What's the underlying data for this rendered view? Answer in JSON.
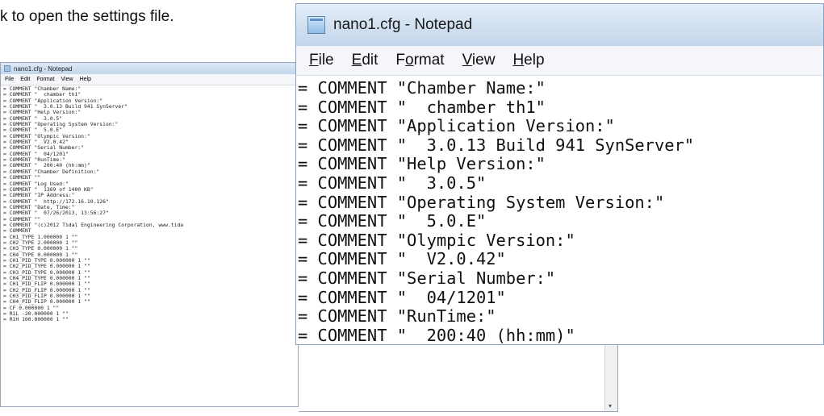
{
  "caption": "k to open the settings file.",
  "small_window": {
    "title": "nano1.cfg - Notepad",
    "menu": [
      "File",
      "Edit",
      "Format",
      "View",
      "Help"
    ],
    "text": "= COMMENT \"Chamber Name:\"\n= COMMENT \"  chamber th1\"\n= COMMENT \"Application Version:\"\n= COMMENT \"  3.0.13 Build 941 SynServer\"\n= COMMENT \"Help Version:\"\n= COMMENT \"  3.0.5\"\n= COMMENT \"Operating System Version:\"\n= COMMENT \"  5.0.E\"\n= COMMENT \"Olympic Version:\"\n= COMMENT \"  V2.0.42\"\n= COMMENT \"Serial Number:\"\n= COMMENT \"  04/1201\"\n= COMMENT \"RunTime:\"\n= COMMENT \"  200:40 (hh:mm)\"\n= COMMENT \"Chamber Definition:\"\n= COMMENT \"\"\n= COMMENT \"Log Used:\"\n= COMMENT \"  1369 of 1400 KB\"\n= COMMENT \"IP Address:\"\n= COMMENT \"  http://172.16.10.126\"\n= COMMENT \"Date, Time:\"\n= COMMENT \"  07/26/2013, 13:56:27\"\n= COMMENT \"\"\n= COMMENT \"(c)2012 Tidal Engineering Corporation, www.tida\n= COMMENT\n= CH1_TYPE 1.000000 1 \"\"\n= CH2_TYPE 2.000000 1 \"\"\n= CH3_TYPE 0.000000 1 \"\"\n= CH4_TYPE 0.000000 1 \"\"\n= CH1_PID_TYPE 0.000000 1 \"\"\n= CH2_PID_TYPE 0.000000 1 \"\"\n= CH3_PID_TYPE 0.000000 1 \"\"\n= CH4_PID_TYPE 0.000000 1 \"\"\n= CH1_PID_FLIP 0.000000 1 \"\"\n= CH2_PID_FLIP 0.000000 1 \"\"\n= CH3_PID_FLIP 0.000000 1 \"\"\n= CH4_PID_FLIP 0.000000 1 \"\"\n= CF 0.000000 1 \"\"\n= R1L -20.000000 1 \"\"\n= R1H 100.000000 1 \"\""
  },
  "big_window": {
    "title": "nano1.cfg - Notepad",
    "menu": [
      {
        "key": "F",
        "rest": "ile"
      },
      {
        "key": "E",
        "rest": "dit"
      },
      {
        "pre": "F",
        "key": "o",
        "rest": "rmat"
      },
      {
        "key": "V",
        "rest": "iew"
      },
      {
        "key": "H",
        "rest": "elp"
      }
    ],
    "text": "= COMMENT \"Chamber Name:\"\n= COMMENT \"  chamber th1\"\n= COMMENT \"Application Version:\"\n= COMMENT \"  3.0.13 Build 941 SynServer\"\n= COMMENT \"Help Version:\"\n= COMMENT \"  3.0.5\"\n= COMMENT \"Operating System Version:\"\n= COMMENT \"  5.0.E\"\n= COMMENT \"Olympic Version:\"\n= COMMENT \"  V2.0.42\"\n= COMMENT \"Serial Number:\"\n= COMMENT \"  04/1201\"\n= COMMENT \"RunTime:\"\n= COMMENT \"  200:40 (hh:mm)\"\n= COMMENT \"Chamber Definition:\""
  }
}
